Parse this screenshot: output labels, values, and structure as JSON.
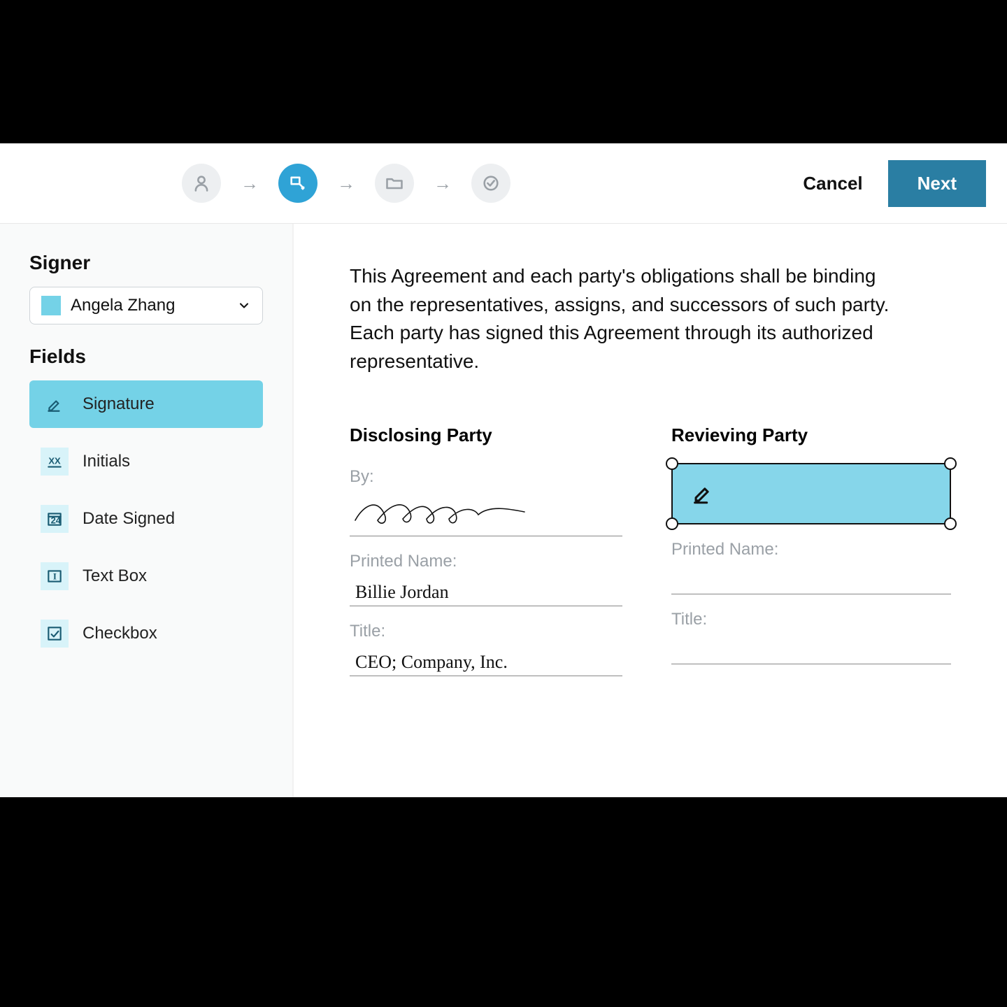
{
  "topbar": {
    "cancel_label": "Cancel",
    "next_label": "Next",
    "steps": [
      "person",
      "place-fields",
      "folder",
      "confirm"
    ],
    "active_step_index": 1
  },
  "sidebar": {
    "signer_heading": "Signer",
    "selected_signer": "Angela Zhang",
    "signer_color": "#74d2e7",
    "fields_heading": "Fields",
    "fields": [
      {
        "id": "signature",
        "label": "Signature",
        "active": true
      },
      {
        "id": "initials",
        "label": "Initials",
        "active": false
      },
      {
        "id": "date",
        "label": "Date Signed",
        "active": false
      },
      {
        "id": "textbox",
        "label": "Text Box",
        "active": false
      },
      {
        "id": "checkbox",
        "label": "Checkbox",
        "active": false
      }
    ]
  },
  "document": {
    "paragraph": "This Agreement and each party's obligations shall be binding on the representatives, assigns, and successors of such party. Each party has signed this Agreement through its authorized representative.",
    "disclosing": {
      "heading": "Disclosing Party",
      "by_label": "By:",
      "printed_name_label": "Printed Name:",
      "printed_name_value": "Billie Jordan",
      "title_label": "Title:",
      "title_value": "CEO; Company, Inc."
    },
    "receiving": {
      "heading": "Revieving Party",
      "printed_name_label": "Printed Name:",
      "title_label": "Title:",
      "placed_field_type": "signature"
    }
  }
}
